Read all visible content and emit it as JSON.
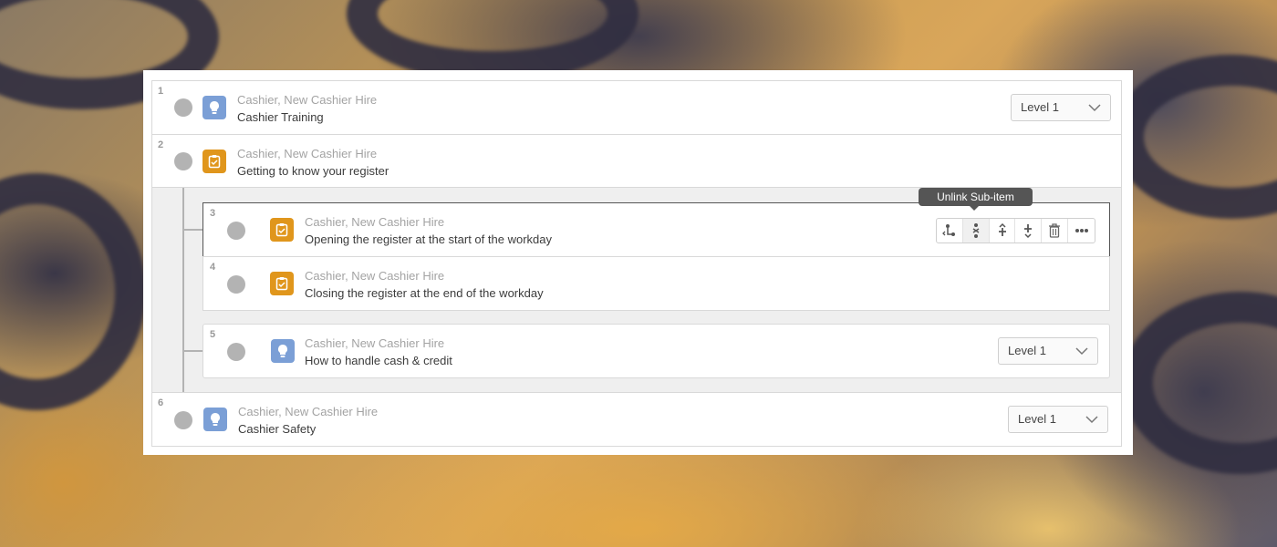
{
  "items": [
    {
      "number": "1",
      "category": "Cashier, New Cashier Hire",
      "title": "Cashier Training",
      "icon": "lightbulb-icon",
      "level": "Level 1"
    },
    {
      "number": "2",
      "category": "Cashier, New Cashier Hire",
      "title": "Getting to know your register",
      "icon": "clipboard-check-icon"
    },
    {
      "number": "3",
      "category": "Cashier, New Cashier Hire",
      "title": "Opening the register at the start of the workday",
      "icon": "clipboard-check-icon"
    },
    {
      "number": "4",
      "category": "Cashier, New Cashier Hire",
      "title": "Closing the register at the end of the workday",
      "icon": "clipboard-check-icon"
    },
    {
      "number": "5",
      "category": "Cashier, New Cashier Hire",
      "title": "How to handle cash & credit",
      "icon": "lightbulb-icon",
      "level": "Level 1"
    },
    {
      "number": "6",
      "category": "Cashier, New Cashier Hire",
      "title": "Cashier Safety",
      "icon": "lightbulb-icon",
      "level": "Level 1"
    }
  ],
  "toolbar": {
    "tooltip": "Unlink Sub-item",
    "buttons": [
      "link-subitem-icon",
      "unlink-subitem-icon",
      "move-up-icon",
      "move-down-icon",
      "trash-icon",
      "more-icon"
    ]
  },
  "colors": {
    "lesson_icon_bg": "#7b9fd6",
    "task_icon_bg": "#e0961c",
    "connector": "#b3b3b3",
    "tooltip_bg": "#555555"
  }
}
